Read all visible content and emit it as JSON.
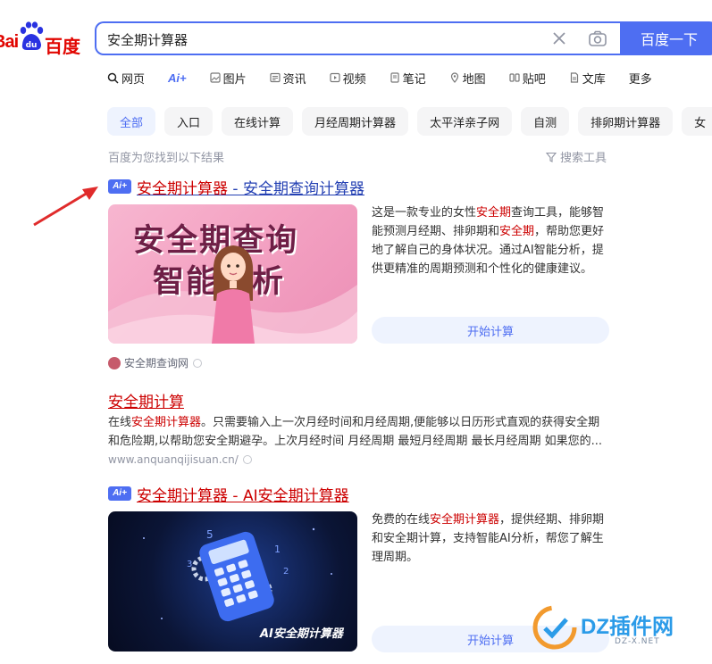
{
  "logo": {
    "left_text": "Bai",
    "right_text": "百度"
  },
  "search": {
    "query": "安全期计算器",
    "button_label": "百度一下"
  },
  "tabs": [
    {
      "label": "网页",
      "icon": "search-icon"
    },
    {
      "label": "Ai+",
      "icon": "ai-icon"
    },
    {
      "label": "图片",
      "icon": "image-icon"
    },
    {
      "label": "资讯",
      "icon": "news-icon"
    },
    {
      "label": "视频",
      "icon": "video-icon"
    },
    {
      "label": "笔记",
      "icon": "note-icon"
    },
    {
      "label": "地图",
      "icon": "map-icon"
    },
    {
      "label": "贴吧",
      "icon": "tieba-icon"
    },
    {
      "label": "文库",
      "icon": "doc-icon"
    },
    {
      "label": "更多",
      "icon": ""
    }
  ],
  "chips": [
    "全部",
    "入口",
    "在线计算",
    "月经周期计算器",
    "太平洋亲子网",
    "自测",
    "排卵期计算器",
    "女"
  ],
  "results_info": {
    "found_text": "百度为您找到以下结果",
    "tools_label": "搜索工具"
  },
  "results": {
    "r1": {
      "badge": "Ai+",
      "title_a": "安全期计算器",
      "title_b": " - 安全期查询计算器",
      "image_text_1": "安全期查询",
      "image_text_2": "智能分析",
      "desc_1": "这是一款专业的女性",
      "desc_hl_1": "安全期",
      "desc_2": "查询工具，能够智能预测月经期、排卵期和",
      "desc_hl_2": "安全期",
      "desc_3": "，帮助您更好地了解自己的身体状况。通过AI智能分析，提供更精准的周期预测和个性化的健康建议。",
      "button": "开始计算",
      "source": "安全期查询网"
    },
    "r2": {
      "title": "安全期计算",
      "desc_1": "在线",
      "desc_hl": "安全期计算器",
      "desc_2": "。只需要输入上一次月经时间和月经周期,便能够以日历形式直观的获得安全期和危险期,以帮助您安全期避孕。上次月经时间 月经周期 最短月经周期 最长月经周期 如果您的...",
      "url": "www.anquanqijisuan.cn/"
    },
    "r3": {
      "badge": "Ai+",
      "title_a": "安全期计算器",
      "title_b": " - AI安全期计算器",
      "image_caption": "AI安全期计算器",
      "desc_1": "免费的在线",
      "desc_hl": "安全期计算器",
      "desc_2": "，提供经期、排卵期和安全期计算，支持智能AI分析，帮您了解生理周期。",
      "button": "开始计算"
    }
  },
  "watermark": {
    "logo_text": "DZ插件网",
    "sub_text": "DZ-X.NET"
  },
  "colors": {
    "brand_blue": "#4e6ef2",
    "baidu_red": "#e10601",
    "title_blue": "#2440b3",
    "highlight_red": "#cc0000"
  }
}
